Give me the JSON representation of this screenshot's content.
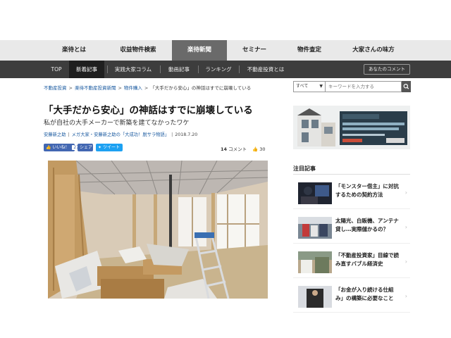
{
  "top_nav": {
    "items": [
      {
        "label": "楽待とは"
      },
      {
        "label": "収益物件検索"
      },
      {
        "label": "楽待新聞"
      },
      {
        "label": "セミナー"
      },
      {
        "label": "物件査定"
      },
      {
        "label": "大家さんの味方"
      }
    ],
    "active_index": 2
  },
  "sub_nav": {
    "items": [
      {
        "label": "TOP"
      },
      {
        "label": "新着記事"
      },
      {
        "label": "実践大家コラム"
      },
      {
        "label": "動画記事"
      },
      {
        "label": "ランキング"
      },
      {
        "label": "不動産投資とは"
      }
    ],
    "active_index": 1,
    "comment_button": "あなたのコメント"
  },
  "breadcrumb": {
    "items": [
      "不動産投資",
      "楽待不動産投資新聞",
      "物件購入"
    ],
    "separator": ">",
    "current": "「大手だから安心」の神話はすでに崩壊している"
  },
  "search": {
    "scope": "すべて",
    "placeholder": "キーワードを入力する",
    "icon": "search-icon"
  },
  "article": {
    "title": "「大手だから安心」の神話はすでに崩壊している",
    "subtitle": "私が自社の大手メーカーで新築を建てなかったワケ",
    "author": "安藤新之助",
    "series": "メガ大家・安藤新之助の「大成功！脱サラ物語」",
    "date": "2018.7.20",
    "separator": "|",
    "comment_count": "14",
    "comment_label": "コメント",
    "like_count": "30"
  },
  "social": {
    "like_label": "いいね！",
    "like_count": "27",
    "share_label": "シェア",
    "tweet_label": "ツイート"
  },
  "sidebar": {
    "heading": "注目記事",
    "featured": [
      {
        "title": "「モンスター借主」に対抗するための契約方法"
      },
      {
        "title": "太陽光、白販機、アンテナ貸し…実際儲かるの？"
      },
      {
        "title": "「不動産投資家」目線で読み直すバブル経済史"
      },
      {
        "title": "「お金が入り続ける仕組み」の構築に必要なこと"
      }
    ]
  },
  "colors": {
    "top_nav_bg": "#e9e9e9",
    "sub_nav_bg": "#3d3d3d",
    "link": "#1a5aa0",
    "facebook": "#4267b2",
    "twitter": "#1da1f2"
  }
}
